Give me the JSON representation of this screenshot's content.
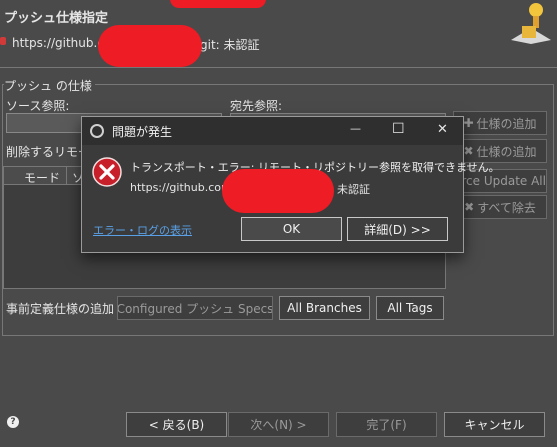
{
  "wizard": {
    "title": "プッシュ仕様指定",
    "url_prefix": "https://github.com",
    "status_suffix": "git: 未認証",
    "group_label": "プッシュ の仕様",
    "source_ref_label": "ソース参照:",
    "dest_ref_label": "宛先参照:",
    "delete_ref_label": "削除するリモート",
    "table_col_mode": "モード",
    "table_col_source": "ソ",
    "add_spec_button": "仕様の追加",
    "add_spec_button2": "仕様の追加",
    "force_update_all_button": "orce Update All",
    "remove_all_button": "すべて除去",
    "predefined_label": "事前定義仕様の追加",
    "configured_push_specs_button": "Configured プッシュ Specs",
    "all_branches_button": "All Branches",
    "all_tags_button": "All Tags",
    "back_button": "< 戻る(B)",
    "next_button": "次へ(N) >",
    "finish_button": "完了(F)",
    "cancel_button": "キャンセル",
    "help_icon": "?"
  },
  "dialog": {
    "title": "問題が発生",
    "message": "トランスポート・エラー: リモート・リポジトリー参照を取得できません。",
    "url_prefix": "https://github.com",
    "url_suffix": "未認証",
    "error_log_link": "エラー・ログの表示",
    "ok_button": "OK",
    "details_button": "詳細(D) >>",
    "minimize_glyph": "—",
    "maximize_glyph": "☐",
    "close_glyph": "✕"
  },
  "colors": {
    "background": "#4a4a4a",
    "dialog_background": "#3b3b3b",
    "error_red": "#c8202a",
    "link": "#5aa0e6",
    "redaction": "#ee1c24"
  }
}
